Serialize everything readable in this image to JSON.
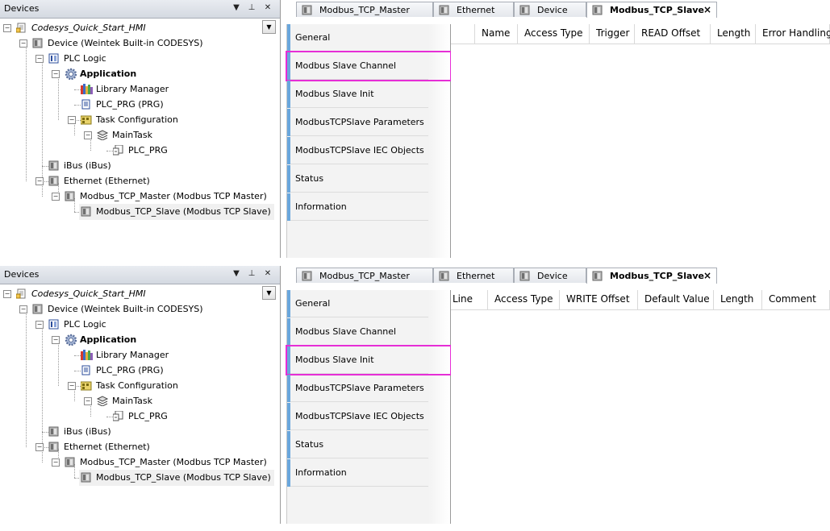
{
  "panels": [
    {
      "devices_pane": {
        "title": "Devices",
        "pin_icon": "pin-icon",
        "close_icon": "close-icon",
        "tree": [
          {
            "label": "Codesys_Quick_Start_HMI",
            "level": 0,
            "italic": true,
            "icon": "project-icon"
          },
          {
            "label": "Device (Weintek Built-in CODESYS)",
            "level": 1,
            "icon": "device-icon"
          },
          {
            "label": "PLC Logic",
            "level": 2,
            "icon": "plc-logic-icon"
          },
          {
            "label": "Application",
            "level": 3,
            "bold": true,
            "icon": "application-gear-icon"
          },
          {
            "label": "Library Manager",
            "level": 4,
            "icon": "library-icon"
          },
          {
            "label": "PLC_PRG (PRG)",
            "level": 4,
            "icon": "program-icon"
          },
          {
            "label": "Task Configuration",
            "level": 4,
            "icon": "task-config-icon"
          },
          {
            "label": "MainTask",
            "level": 5,
            "icon": "task-icon"
          },
          {
            "label": "PLC_PRG",
            "level": 6,
            "icon": "call-icon"
          },
          {
            "label": "iBus (iBus)",
            "level": 2,
            "icon": "bus-icon"
          },
          {
            "label": "Ethernet (Ethernet)",
            "level": 2,
            "icon": "ethernet-icon"
          },
          {
            "label": "Modbus_TCP_Master (Modbus TCP Master)",
            "level": 3,
            "icon": "modbus-master-icon"
          },
          {
            "label": "Modbus_TCP_Slave (Modbus TCP Slave)",
            "level": 4,
            "icon": "modbus-slave-icon",
            "selected": true
          }
        ]
      },
      "tabs": [
        {
          "label": "Modbus_TCP_Master",
          "active": false
        },
        {
          "label": "Ethernet",
          "active": false
        },
        {
          "label": "Device",
          "active": false
        },
        {
          "label": "Modbus_TCP_Slave",
          "active": true,
          "close": "×"
        }
      ],
      "sidebar": [
        {
          "label": "General"
        },
        {
          "label": "Modbus Slave Channel",
          "highlighted": true
        },
        {
          "label": "Modbus Slave Init"
        },
        {
          "label": "ModbusTCPSlave Parameters"
        },
        {
          "label": "ModbusTCPSlave IEC Objects"
        },
        {
          "label": "Status"
        },
        {
          "label": "Information"
        }
      ],
      "columns": [
        "",
        "Name",
        "Access Type",
        "Trigger",
        "READ Offset",
        "Length",
        "Error Handling"
      ]
    },
    {
      "devices_pane": {
        "title": "Devices",
        "pin_icon": "pin-icon",
        "close_icon": "close-icon",
        "tree": [
          {
            "label": "Codesys_Quick_Start_HMI",
            "level": 0,
            "italic": true,
            "icon": "project-icon"
          },
          {
            "label": "Device (Weintek Built-in CODESYS)",
            "level": 1,
            "icon": "device-icon"
          },
          {
            "label": "PLC Logic",
            "level": 2,
            "icon": "plc-logic-icon"
          },
          {
            "label": "Application",
            "level": 3,
            "bold": true,
            "icon": "application-gear-icon"
          },
          {
            "label": "Library Manager",
            "level": 4,
            "icon": "library-icon"
          },
          {
            "label": "PLC_PRG (PRG)",
            "level": 4,
            "icon": "program-icon"
          },
          {
            "label": "Task Configuration",
            "level": 4,
            "icon": "task-config-icon"
          },
          {
            "label": "MainTask",
            "level": 5,
            "icon": "task-icon"
          },
          {
            "label": "PLC_PRG",
            "level": 6,
            "icon": "call-icon"
          },
          {
            "label": "iBus (iBus)",
            "level": 2,
            "icon": "bus-icon"
          },
          {
            "label": "Ethernet (Ethernet)",
            "level": 2,
            "icon": "ethernet-icon"
          },
          {
            "label": "Modbus_TCP_Master (Modbus TCP Master)",
            "level": 3,
            "icon": "modbus-master-icon"
          },
          {
            "label": "Modbus_TCP_Slave (Modbus TCP Slave)",
            "level": 4,
            "icon": "modbus-slave-icon",
            "selected": true
          }
        ]
      },
      "tabs": [
        {
          "label": "Modbus_TCP_Master",
          "active": false
        },
        {
          "label": "Ethernet",
          "active": false
        },
        {
          "label": "Device",
          "active": false
        },
        {
          "label": "Modbus_TCP_Slave",
          "active": true,
          "close": "×"
        }
      ],
      "sidebar": [
        {
          "label": "General"
        },
        {
          "label": "Modbus Slave Channel"
        },
        {
          "label": "Modbus Slave Init",
          "highlighted": true
        },
        {
          "label": "ModbusTCPSlave Parameters"
        },
        {
          "label": "ModbusTCPSlave IEC Objects"
        },
        {
          "label": "Status"
        },
        {
          "label": "Information"
        }
      ],
      "columns": [
        "Line",
        "Access Type",
        "WRITE Offset",
        "Default Value",
        "Length",
        "Comment"
      ]
    }
  ],
  "colors": {
    "highlight": "#e62ed6",
    "sidebar_accent": "#6aa7dd"
  }
}
